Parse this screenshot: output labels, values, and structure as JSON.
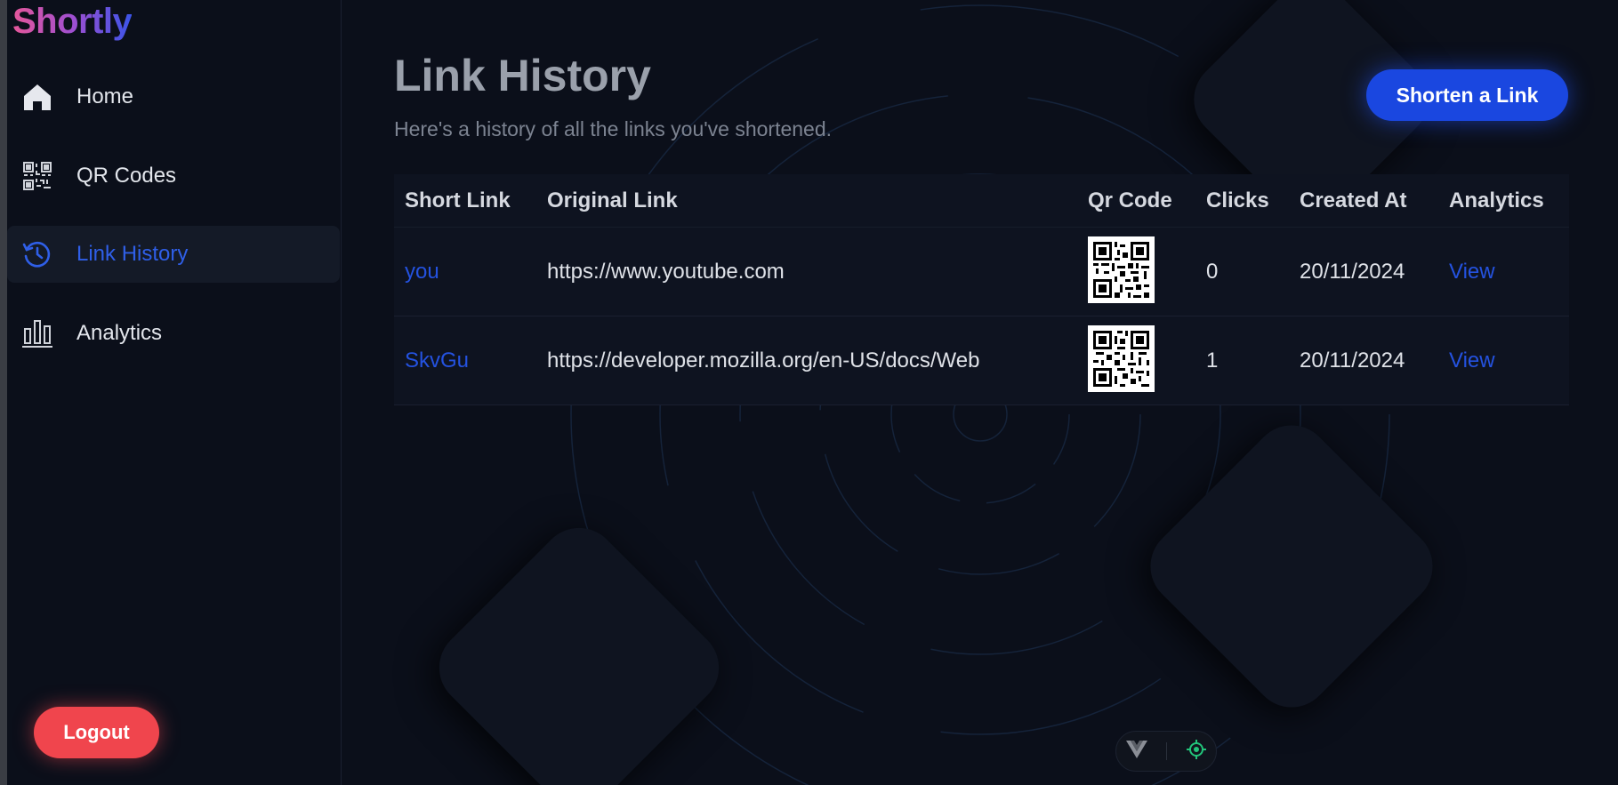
{
  "app": {
    "brand": "Shortly"
  },
  "sidebar": {
    "items": [
      {
        "label": "Home",
        "icon": "home-icon",
        "active": false
      },
      {
        "label": "QR Codes",
        "icon": "qr-code-icon",
        "active": false
      },
      {
        "label": "Link History",
        "icon": "history-icon",
        "active": true
      },
      {
        "label": "Analytics",
        "icon": "bar-chart-icon",
        "active": false
      }
    ],
    "logout_label": "Logout"
  },
  "main": {
    "title": "Link History",
    "subtitle": "Here's a history of all the links you've shortened.",
    "shorten_button": "Shorten a Link",
    "table": {
      "headers": [
        "Short Link",
        "Original Link",
        "Qr Code",
        "Clicks",
        "Created At",
        "Analytics"
      ],
      "rows": [
        {
          "short": "you",
          "original": "https://www.youtube.com",
          "clicks": "0",
          "created": "20/11/2024",
          "analytics": "View"
        },
        {
          "short": "SkvGu",
          "original": "https://developer.mozilla.org/en-US/docs/Web",
          "clicks": "1",
          "created": "20/11/2024",
          "analytics": "View"
        }
      ]
    }
  },
  "devtools": {
    "icons": [
      "vue-logo-icon",
      "target-icon"
    ]
  },
  "colors": {
    "background": "#0b0f1a",
    "accent": "#1a47e0",
    "link": "#2452e0",
    "logout": "#f0454d",
    "brand_gradient": [
      "#e5579a",
      "#3b54e8"
    ]
  }
}
